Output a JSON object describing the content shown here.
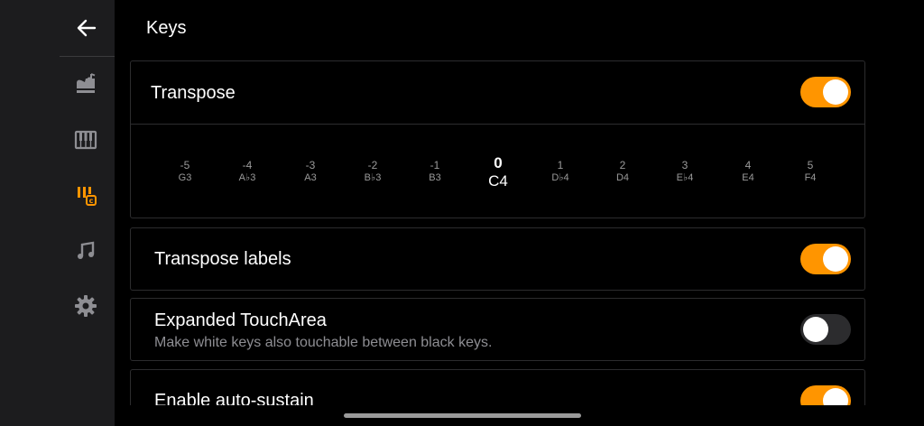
{
  "header": {
    "title": "Keys"
  },
  "sidebar": {
    "back_icon": "arrow-left-icon",
    "items": [
      {
        "id": "piano",
        "icon": "grand-piano-icon",
        "active": false
      },
      {
        "id": "keyboard",
        "icon": "keyboard-icon",
        "active": false
      },
      {
        "id": "keys",
        "icon": "keys-settings-icon",
        "active": true
      },
      {
        "id": "music",
        "icon": "music-note-icon",
        "active": false
      },
      {
        "id": "settings",
        "icon": "gear-icon",
        "active": false
      }
    ]
  },
  "transpose": {
    "label": "Transpose",
    "enabled": true,
    "selected_index": 5,
    "steps": [
      {
        "num": "-5",
        "note": "G3"
      },
      {
        "num": "-4",
        "note": "A♭3"
      },
      {
        "num": "-3",
        "note": "A3"
      },
      {
        "num": "-2",
        "note": "B♭3"
      },
      {
        "num": "-1",
        "note": "B3"
      },
      {
        "num": "0",
        "note": "C4"
      },
      {
        "num": "1",
        "note": "D♭4"
      },
      {
        "num": "2",
        "note": "D4"
      },
      {
        "num": "3",
        "note": "E♭4"
      },
      {
        "num": "4",
        "note": "E4"
      },
      {
        "num": "5",
        "note": "F4"
      }
    ]
  },
  "transpose_labels": {
    "label": "Transpose labels",
    "enabled": true
  },
  "expanded_touch": {
    "label": "Expanded TouchArea",
    "description": "Make white keys also touchable between black keys.",
    "enabled": false
  },
  "auto_sustain": {
    "label": "Enable auto-sustain",
    "enabled": true
  },
  "colors": {
    "accent": "#ff9500",
    "background": "#000000",
    "sidebar": "#1c1c1e"
  }
}
